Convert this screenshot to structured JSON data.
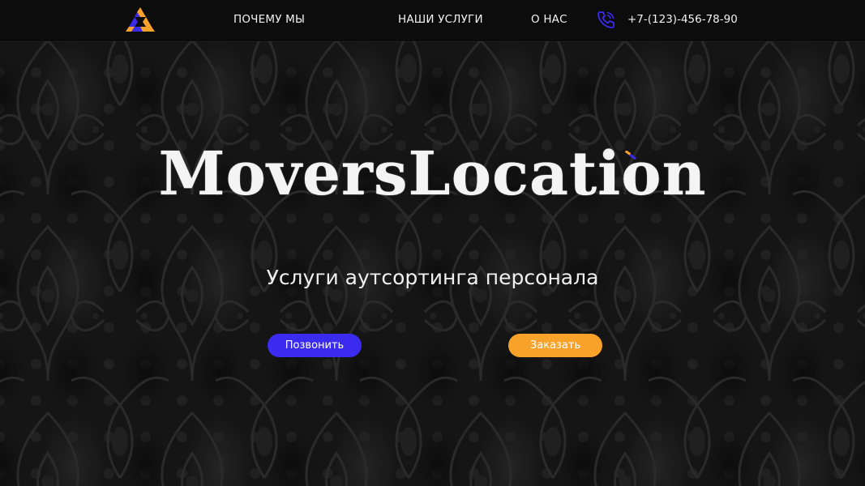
{
  "nav": {
    "logo_icon": "logo-triangle-icon",
    "links": [
      "ПОЧЕМУ МЫ",
      "НАШИ УСЛУГИ",
      "О НАС"
    ],
    "phone_icon": "phone-ringing-icon",
    "phone": "+7-(123)-456-78-90"
  },
  "hero": {
    "title": "MoversLocation",
    "subtitle": "Услуги аутсортинга персонала",
    "call_button": "Позвонить",
    "order_button": "Заказать"
  },
  "colors": {
    "primary": "#3b2bef",
    "accent": "#f8a22a",
    "background": "#151515"
  }
}
